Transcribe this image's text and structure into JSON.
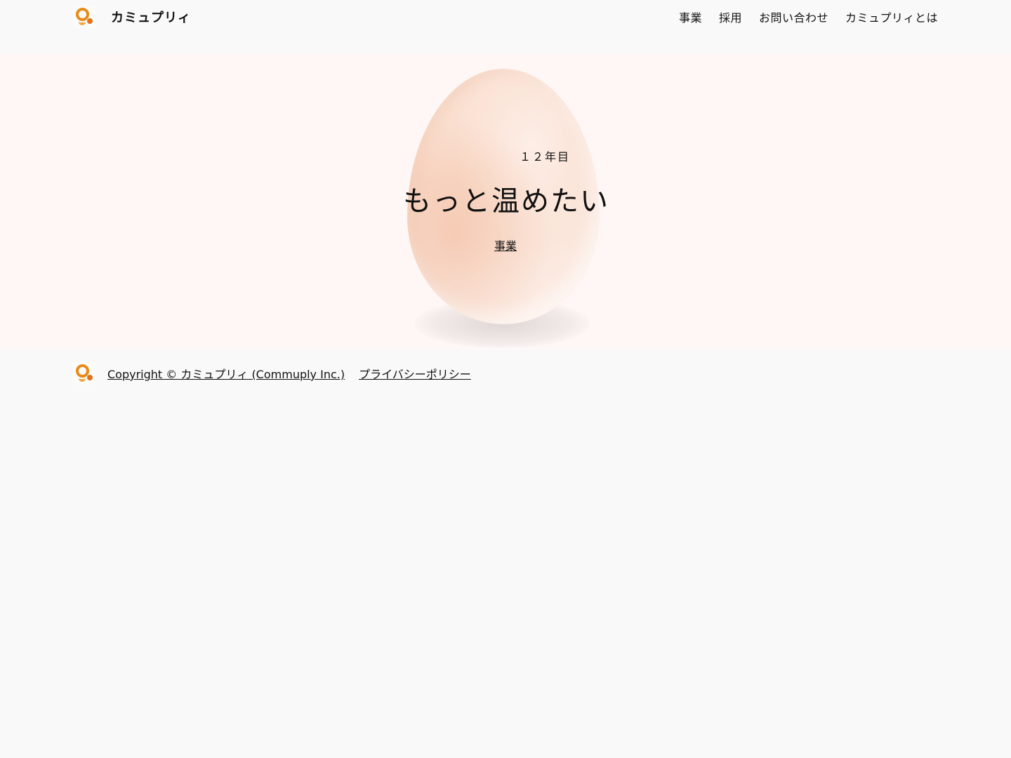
{
  "header": {
    "brand_name": "カミュプリィ",
    "nav": [
      {
        "label": "事業"
      },
      {
        "label": "採用"
      },
      {
        "label": "お問い合わせ"
      },
      {
        "label": "カミュプリィとは"
      }
    ]
  },
  "hero": {
    "subtitle": "１２年目",
    "title": "もっと温めたい",
    "link_label": "事業"
  },
  "footer": {
    "copyright": "Copyright © カミュプリィ (Commuply Inc.)",
    "privacy": "プライバシーポリシー"
  },
  "icons": {
    "logo": "commuply-logo-icon"
  },
  "colors": {
    "page_bg": "#f9f9f9",
    "hero_bg": "#fff7f5",
    "logo_orange": "#e88a1a",
    "egg": "#f9dccb"
  }
}
